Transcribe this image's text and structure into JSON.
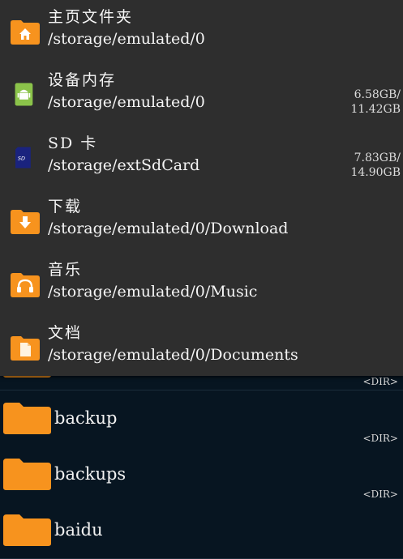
{
  "locations": [
    {
      "title": "主页文件夹",
      "path": "/storage/emulated/0",
      "icon": "home-folder-icon",
      "size1": "",
      "size2": ""
    },
    {
      "title": "设备内存",
      "path": "/storage/emulated/0",
      "icon": "android-icon",
      "size1": "6.58GB/",
      "size2": "11.42GB"
    },
    {
      "title": "SD 卡",
      "path": "/storage/extSdCard",
      "icon": "sd-card-icon",
      "size1": "7.83GB/",
      "size2": "14.90GB"
    },
    {
      "title": "下载",
      "path": "/storage/emulated/0/Download",
      "icon": "download-folder-icon",
      "size1": "",
      "size2": ""
    },
    {
      "title": "音乐",
      "path": "/storage/emulated/0/Music",
      "icon": "music-folder-icon",
      "size1": "",
      "size2": ""
    },
    {
      "title": "文档",
      "path": "/storage/emulated/0/Documents",
      "icon": "documents-folder-icon",
      "size1": "",
      "size2": ""
    }
  ],
  "files": [
    {
      "name": "",
      "tag": "<DIR>"
    },
    {
      "name": "backup",
      "tag": "<DIR>"
    },
    {
      "name": "backups",
      "tag": "<DIR>"
    },
    {
      "name": "baidu",
      "tag": ""
    }
  ],
  "colors": {
    "folder": "#f7931e",
    "panel": "#2e2e2e",
    "list_bg": "#071521",
    "android": "#8bc34a",
    "sd": "#1a237e"
  }
}
